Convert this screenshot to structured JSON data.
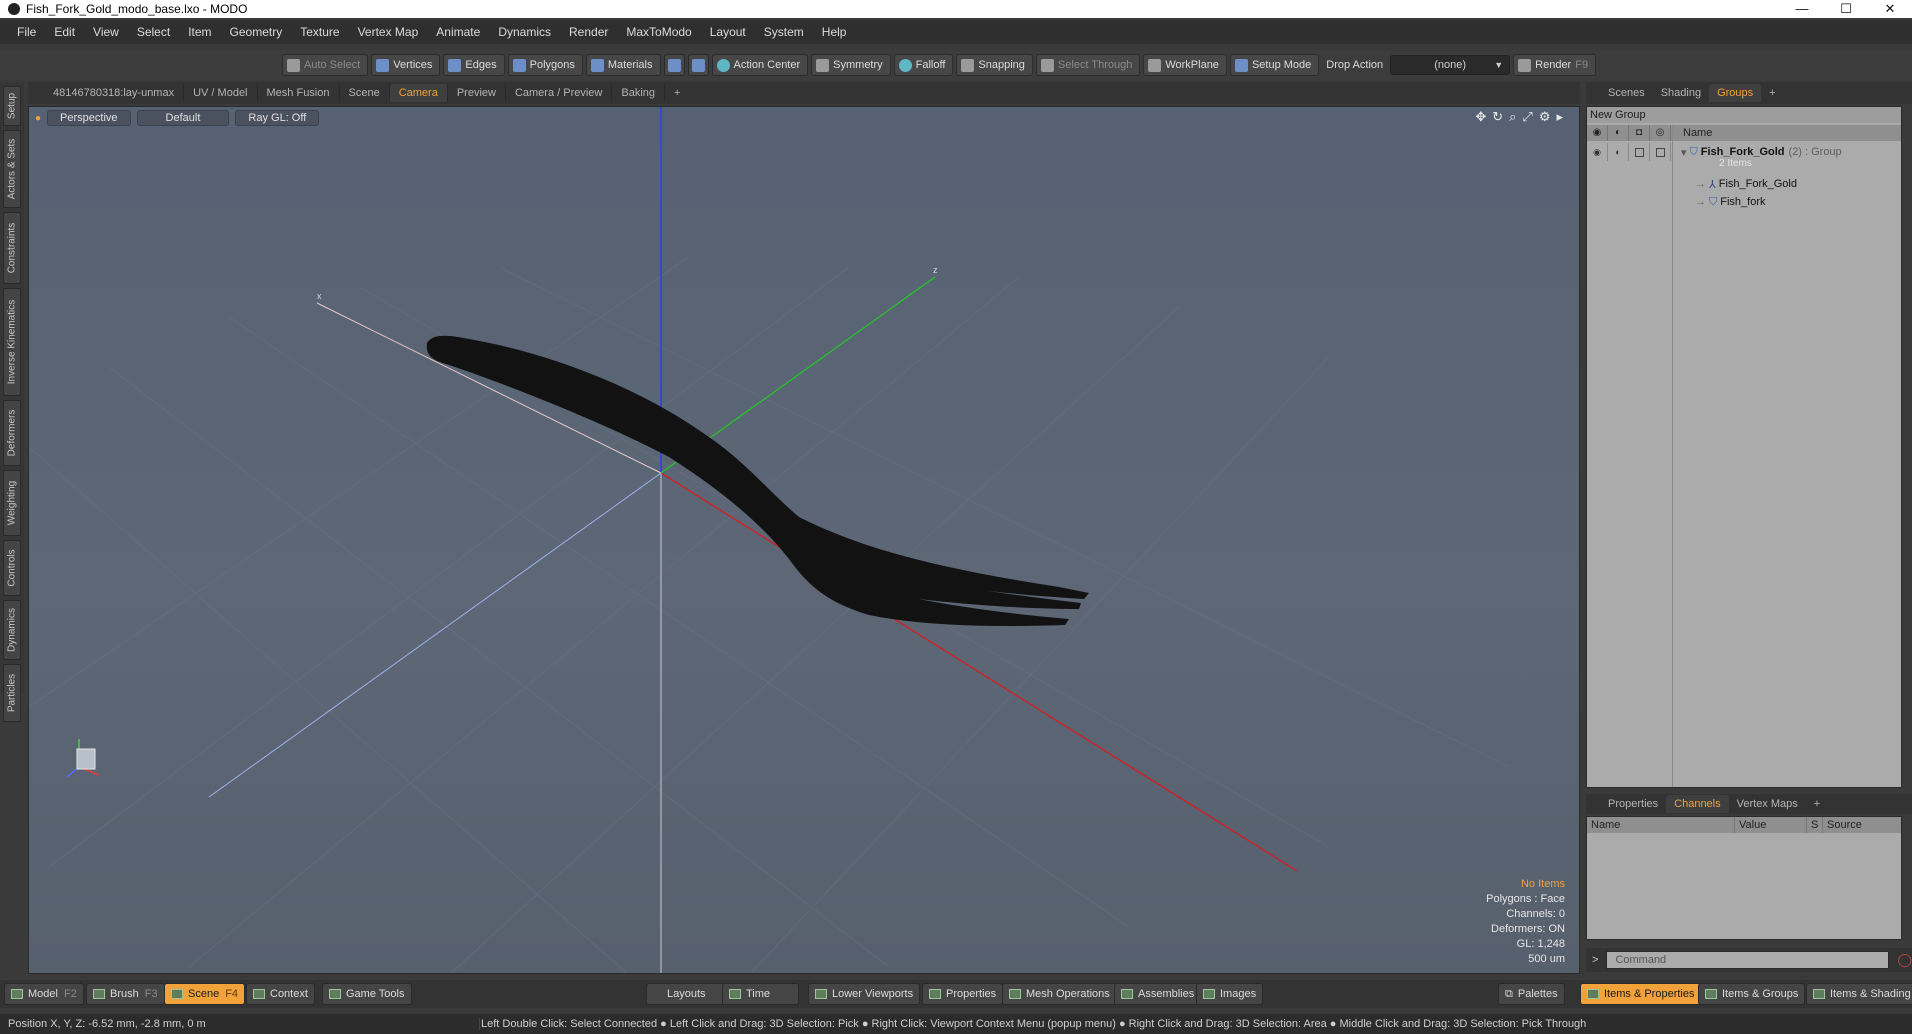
{
  "window": {
    "title": "Fish_Fork_Gold_modo_base.lxo - MODO",
    "minimize": "—",
    "maximize": "☐",
    "close": "✕"
  },
  "menu": [
    "File",
    "Edit",
    "View",
    "Select",
    "Item",
    "Geometry",
    "Texture",
    "Vertex Map",
    "Animate",
    "Dynamics",
    "Render",
    "MaxToModo",
    "Layout",
    "System",
    "Help"
  ],
  "toolbar": {
    "auto_select": "Auto Select",
    "vertices": "Vertices",
    "edges": "Edges",
    "polygons": "Polygons",
    "materials": "Materials",
    "action_center": "Action Center",
    "symmetry": "Symmetry",
    "falloff": "Falloff",
    "snapping": "Snapping",
    "select_through": "Select Through",
    "workplane": "WorkPlane",
    "setup_mode": "Setup Mode",
    "drop_action_label": "Drop Action",
    "drop_action_value": "(none)",
    "render": "Render",
    "render_key": "F9"
  },
  "left_tabs": [
    "Setup",
    "Actors & Sets",
    "Constraints",
    "Inverse Kinematics",
    "Deformers",
    "Weighting",
    "Controls",
    "Dynamics",
    "Particles"
  ],
  "viewport_tabs": [
    "48146780318:lay-unmax",
    "UV / Model",
    "Mesh Fusion",
    "Scene",
    "Camera",
    "Preview",
    "Camera / Preview",
    "Baking",
    "+"
  ],
  "viewport": {
    "projection": "Perspective",
    "shading": "Default",
    "raygl": "Ray GL: Off",
    "axis_x": "x",
    "axis_z": "z",
    "info": {
      "items": "No Items",
      "polygons": "Polygons : Face",
      "channels": "Channels: 0",
      "deformers": "Deformers: ON",
      "gl": "GL: 1,248",
      "scale": "500 um"
    }
  },
  "right_tabs": [
    "Scenes",
    "Shading",
    "Groups",
    "+"
  ],
  "groups": {
    "new_group": "New Group",
    "name_header": "Name",
    "root_name": "Fish_Fork_Gold",
    "root_count": "(2)",
    "root_type": ": Group",
    "root_sub": "2 Items",
    "child1": "Fish_Fork_Gold",
    "child2": "Fish_fork"
  },
  "prop_tabs": [
    "Properties",
    "Channels",
    "Vertex Maps",
    "+"
  ],
  "channels": {
    "name": "Name",
    "value": "Value",
    "s": "S",
    "source": "Source"
  },
  "command": {
    "prompt": ">",
    "placeholder": "Command"
  },
  "bottom": {
    "model": "Model",
    "model_key": "F2",
    "brush": "Brush",
    "brush_key": "F3",
    "scene": "Scene",
    "scene_key": "F4",
    "context": "Context",
    "game_tools": "Game Tools",
    "layouts": "Layouts",
    "time": "Time",
    "lower_viewports": "Lower Viewports",
    "properties": "Properties",
    "mesh_operations": "Mesh Operations",
    "assemblies": "Assemblies",
    "images": "Images",
    "palettes": "Palettes",
    "items_properties": "Items & Properties",
    "items_groups": "Items & Groups",
    "items_shading": "Items & Shading"
  },
  "status": {
    "position": "Position X, Y, Z:  -6.52 mm, -2.8 mm, 0 m",
    "hints": "Left Double Click: Select Connected ● Left Click and Drag: 3D Selection: Pick ● Right Click: Viewport Context Menu (popup menu) ● Right Click and Drag: 3D Selection: Area ● Middle Click and Drag: 3D Selection: Pick Through"
  },
  "colors": {
    "accent": "#f2a23a",
    "viewport_bg": "#5d6776",
    "fork": "#111111"
  }
}
